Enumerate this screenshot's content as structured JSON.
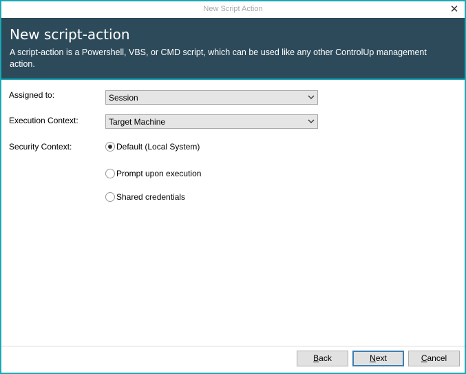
{
  "window": {
    "title": "New Script Action",
    "close_glyph": "✕"
  },
  "banner": {
    "heading": "New script-action",
    "description": "A script-action is a Powershell, VBS, or CMD script, which can be used like any other ControlUp management action."
  },
  "form": {
    "assigned_to": {
      "label": "Assigned to:",
      "value": "Session"
    },
    "execution_context": {
      "label": "Execution Context:",
      "value": "Target Machine"
    },
    "security_context": {
      "label": "Security Context:",
      "options": [
        {
          "label": "Default (Local System)",
          "checked": true
        },
        {
          "label": "Prompt upon execution",
          "checked": false
        },
        {
          "label": "Shared credentials",
          "checked": false
        }
      ]
    }
  },
  "buttons": {
    "back": {
      "mnemonic": "B",
      "rest": "ack"
    },
    "next": {
      "mnemonic": "N",
      "rest": "ext"
    },
    "cancel": {
      "mnemonic": "C",
      "rest": "ancel"
    }
  },
  "colors": {
    "window_border": "#17a9b7",
    "banner_bg": "#2c4a5a"
  }
}
